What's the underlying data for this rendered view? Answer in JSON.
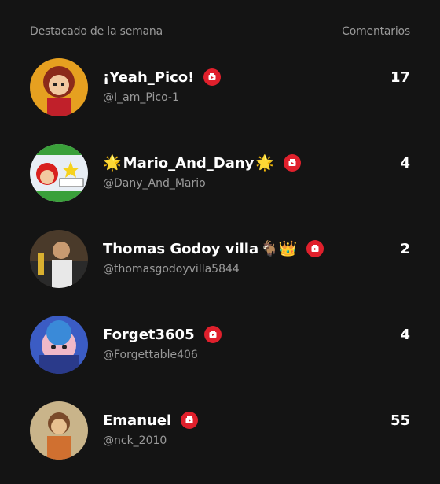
{
  "header": {
    "title": "Destacado de la semana",
    "column": "Comentarios"
  },
  "rows": [
    {
      "name": "¡Yeah_Pico!",
      "pre_emoji": "",
      "post_emoji": "",
      "handle": "@I_am_Pico-1",
      "count": "17",
      "avatar_color": "#e6a020"
    },
    {
      "name": "Mario_And_Dany",
      "pre_emoji": "🌟",
      "post_emoji": "🌟",
      "handle": "@Dany_And_Mario",
      "count": "4",
      "avatar_color": "#e8eef5"
    },
    {
      "name": "Thomas Godoy villa",
      "pre_emoji": "",
      "post_emoji": "🐐👑",
      "handle": "@thomasgodoyvilla5844",
      "count": "2",
      "avatar_color": "#4a3a2a"
    },
    {
      "name": "Forget3605",
      "pre_emoji": "",
      "post_emoji": "",
      "handle": "@Forgettable406",
      "count": "4",
      "avatar_color": "#3b5cc4"
    },
    {
      "name": "Emanuel",
      "pre_emoji": "",
      "post_emoji": "",
      "handle": "@nck_2010",
      "count": "55",
      "avatar_color": "#c9b48a"
    }
  ],
  "badge_color": "#e0202c"
}
